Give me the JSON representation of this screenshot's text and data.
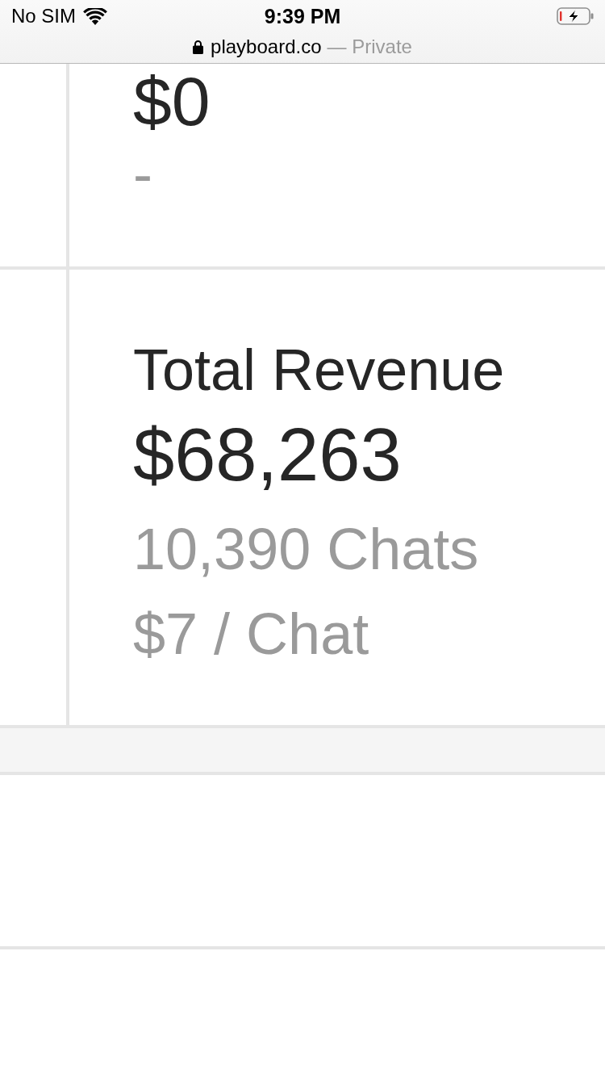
{
  "status_bar": {
    "carrier": "No SIM",
    "time": "9:39 PM",
    "charging": true
  },
  "address_bar": {
    "secure": true,
    "url": "playboard.co",
    "mode": "— Private"
  },
  "stats": [
    {
      "value": "$0",
      "details": [
        "-"
      ]
    },
    {
      "label": "Total Revenue",
      "value": "$68,263",
      "details": [
        "10,390 Chats",
        "$7 / Chat"
      ]
    }
  ]
}
